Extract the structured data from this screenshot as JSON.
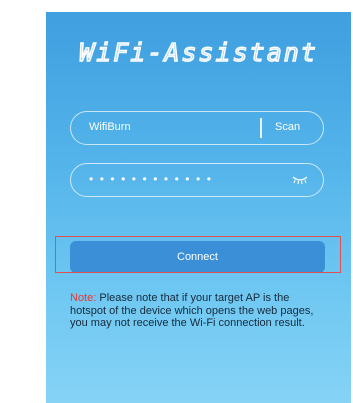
{
  "app": {
    "title": "WiFi-Assistant"
  },
  "form": {
    "ssid_value": "WifiBurn",
    "scan_label": "Scan",
    "password_masked": "••••••••••••",
    "password_toggle_icon": "eye-closed-icon",
    "connect_label": "Connect"
  },
  "note": {
    "label": "Note:",
    "text": " Please note that if your target AP is the hotspot of the device which opens the web pages, you may not receive the Wi-Fi connection result."
  },
  "colors": {
    "background_top": "#3f9fe0",
    "background_bottom": "#86d3f6",
    "button": "#3a8fd6",
    "note_label": "#e23a3a",
    "highlight": "#e05052"
  }
}
